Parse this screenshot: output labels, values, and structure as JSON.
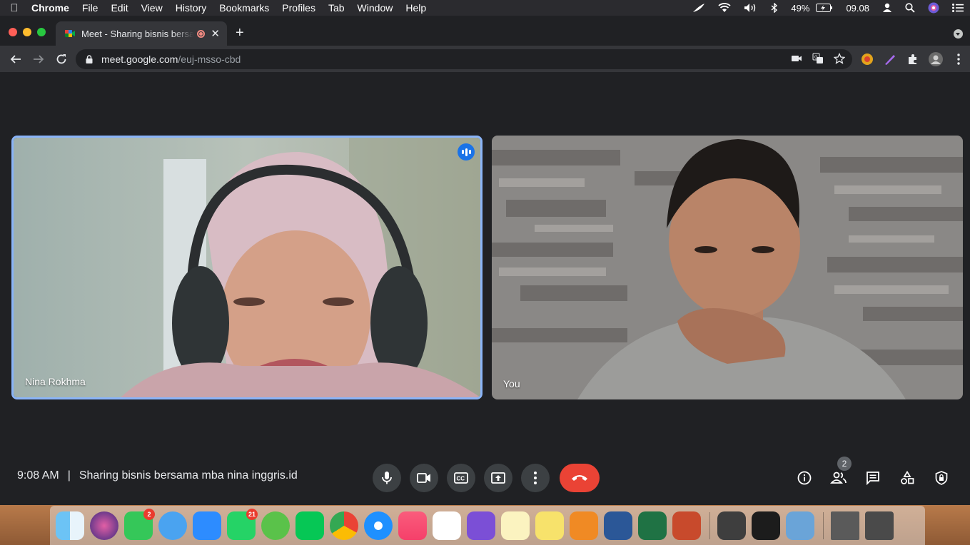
{
  "menubar": {
    "app_name": "Chrome",
    "items": [
      "File",
      "Edit",
      "View",
      "History",
      "Bookmarks",
      "Profiles",
      "Tab",
      "Window",
      "Help"
    ],
    "battery": "49%",
    "clock": "09.08"
  },
  "tab": {
    "title": "Meet - Sharing bisnis bersama mba nina inggris.id",
    "recording_indicator": "red-dot-icon"
  },
  "address": {
    "host": "meet.google.com",
    "path": "/euj-msso-cbd"
  },
  "participants": [
    {
      "name": "Nina Rokhma",
      "speaking": true
    },
    {
      "name": "You",
      "speaking": false
    }
  ],
  "meeting": {
    "time": "9:08 AM",
    "separator": "|",
    "title": "Sharing bisnis bersama mba nina inggris.id",
    "participant_count": "2"
  },
  "dock": {
    "badges": {
      "facetime": "2",
      "whatsapp": "21"
    }
  },
  "colors": {
    "accent": "#8ab4f8",
    "end_call": "#ea4335",
    "background": "#202124"
  }
}
